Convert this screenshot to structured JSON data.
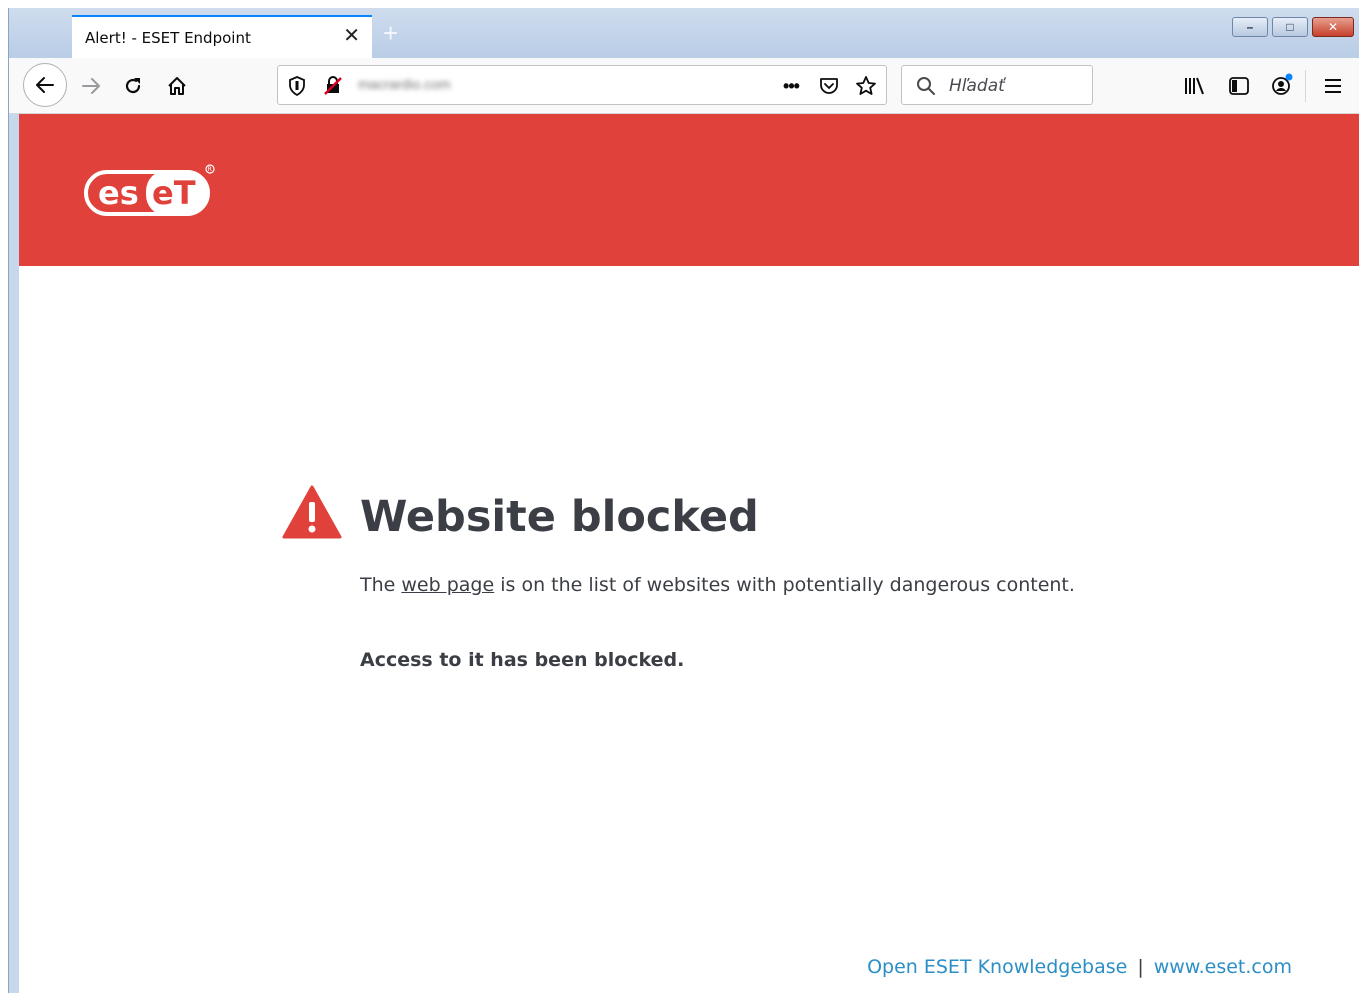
{
  "tab": {
    "title": "Alert! - ESET Endpoint",
    "close_glyph": "✕",
    "new_tab_glyph": "+"
  },
  "window_controls": {
    "minimize": "–",
    "maximize": "□",
    "close": "✕"
  },
  "navbar": {
    "url_text": "macrardio.com",
    "search_placeholder": "Hľadať"
  },
  "icons": {
    "back": "back-arrow-icon",
    "forward": "forward-arrow-icon",
    "reload": "reload-icon",
    "home": "home-icon",
    "shield": "tracking-shield-icon",
    "insecure": "insecure-connection-icon",
    "page_actions": "ellipsis-icon",
    "pocket": "pocket-icon",
    "bookmark": "star-icon",
    "search": "search-icon",
    "library": "library-icon",
    "sidebar": "sidebar-icon",
    "account": "account-icon",
    "menu": "hamburger-menu-icon"
  },
  "colors": {
    "banner": "#e0413a",
    "heading_text": "#3b3f45",
    "link": "#2b8fc6",
    "warning": "#e0413a"
  },
  "page": {
    "logo_text": "eset",
    "heading": "Website blocked",
    "para_before_link": "The ",
    "para_link": "web page",
    "para_after_link": " is on the list of websites with potentially dangerous content.",
    "access_text": "Access to it has been blocked.",
    "footer_link_kb": "Open ESET Knowledgebase",
    "footer_separator": "|",
    "footer_link_site": "www.eset.com"
  }
}
